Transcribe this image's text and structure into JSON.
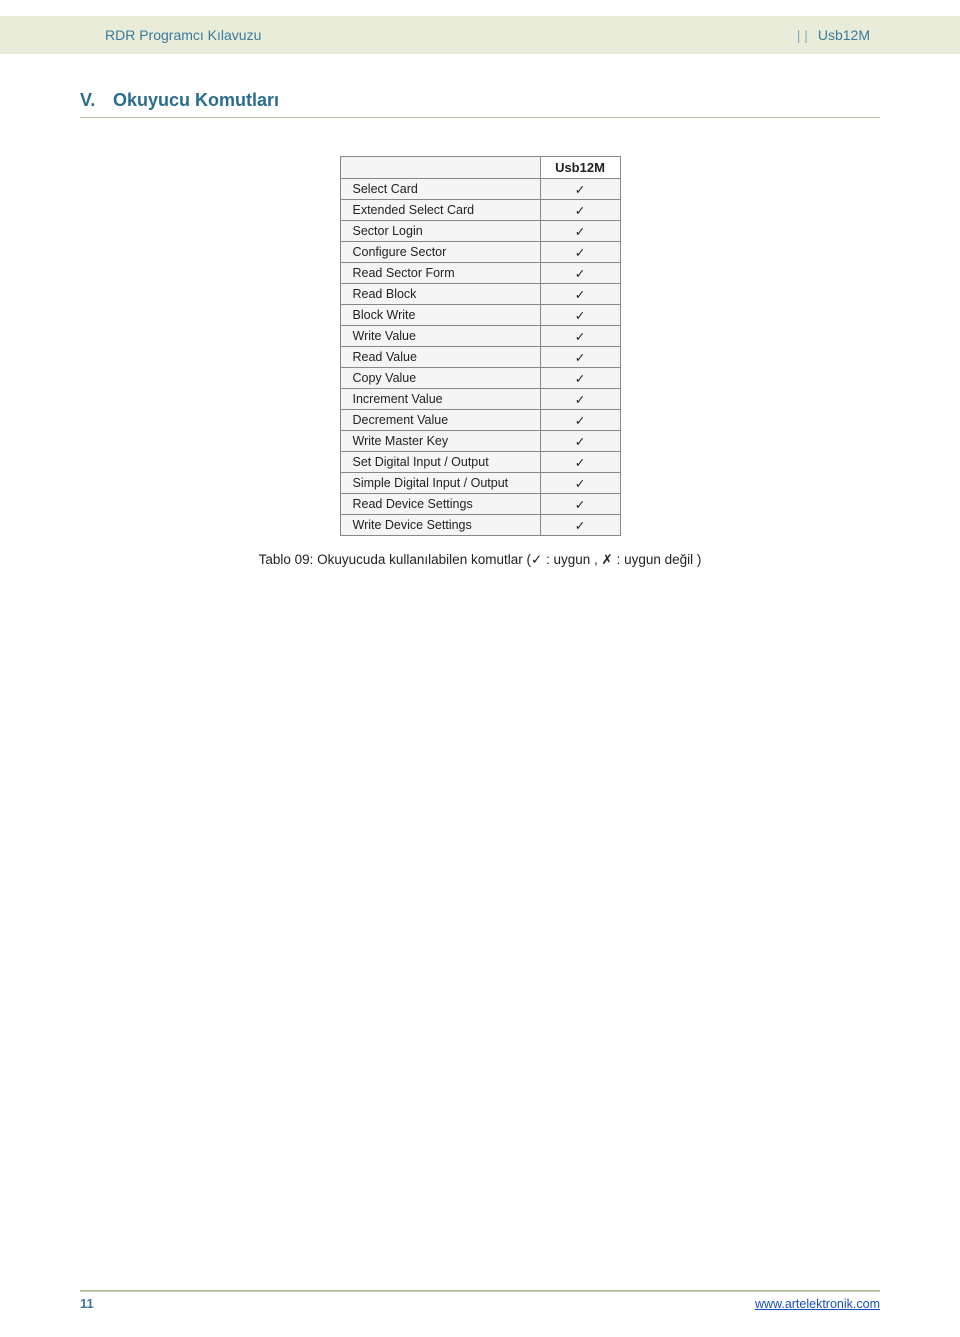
{
  "header": {
    "left": "RDR Programcı Kılavuzu",
    "pipes": "|   |",
    "right": "Usb12M"
  },
  "section": {
    "number": "V.",
    "title": "Okuyucu Komutları"
  },
  "table": {
    "col_header": "Usb12M",
    "rows": [
      {
        "label": "Select Card",
        "mark": "✓"
      },
      {
        "label": "Extended Select Card",
        "mark": "✓"
      },
      {
        "label": "Sector Login",
        "mark": "✓"
      },
      {
        "label": "Configure Sector",
        "mark": "✓"
      },
      {
        "label": "Read Sector Form",
        "mark": "✓"
      },
      {
        "label": "Read Block",
        "mark": "✓"
      },
      {
        "label": "Block Write",
        "mark": "✓"
      },
      {
        "label": "Write Value",
        "mark": "✓"
      },
      {
        "label": "Read Value",
        "mark": "✓"
      },
      {
        "label": "Copy Value",
        "mark": "✓"
      },
      {
        "label": "Increment Value",
        "mark": "✓"
      },
      {
        "label": "Decrement Value",
        "mark": "✓"
      },
      {
        "label": "Write Master Key",
        "mark": "✓"
      },
      {
        "label": "Set Digital Input / Output",
        "mark": "✓"
      },
      {
        "label": "Simple Digital Input / Output",
        "mark": "✓"
      },
      {
        "label": "Read Device Settings",
        "mark": "✓"
      },
      {
        "label": "Write Device Settings",
        "mark": "✓"
      }
    ],
    "caption": "Tablo 09: Okuyucuda kullanılabilen komutlar (✓ : uygun , ✗ : uygun değil )"
  },
  "footer": {
    "page": "11",
    "link": "www.artelektronik.com"
  }
}
